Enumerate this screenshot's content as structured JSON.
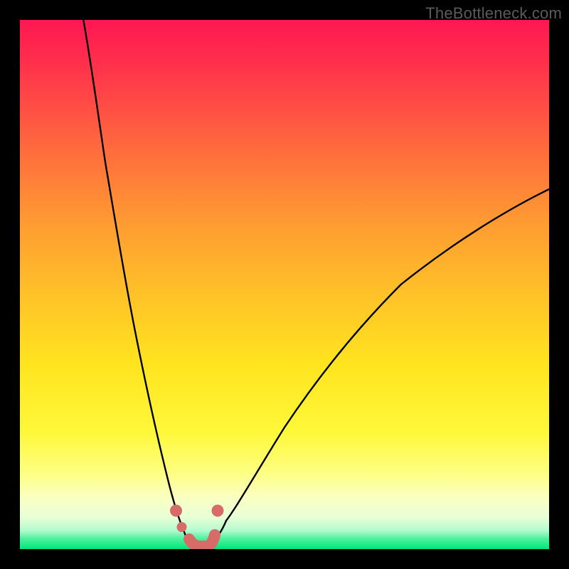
{
  "watermark": "TheBottleneck.com",
  "chart_data": {
    "type": "line",
    "title": "",
    "xlabel": "",
    "ylabel": "",
    "xlim": [
      0,
      100
    ],
    "ylim": [
      0,
      100
    ],
    "series": [
      {
        "name": "left-curve",
        "x": [
          12,
          15,
          18,
          20,
          22,
          24,
          26,
          28,
          29.5,
          31,
          32
        ],
        "y": [
          100,
          80,
          62,
          50,
          40,
          30,
          21,
          13,
          7.5,
          3,
          0.5
        ]
      },
      {
        "name": "right-curve",
        "x": [
          36,
          38,
          41,
          45,
          50,
          56,
          63,
          72,
          82,
          92,
          100
        ],
        "y": [
          0.5,
          3,
          8,
          15,
          23,
          32,
          41,
          50,
          58,
          64,
          68
        ]
      }
    ],
    "markers": [
      {
        "name": "marker-left-upper",
        "x": 29.5,
        "y": 7.3,
        "approx_percent": 7
      },
      {
        "name": "marker-left-mid",
        "x": 30.6,
        "y": 4.2,
        "approx_percent": 4
      },
      {
        "name": "marker-trough-left",
        "x": 32.0,
        "y": 1.3,
        "approx_percent": 1
      },
      {
        "name": "marker-trough-mid",
        "x": 33.7,
        "y": 0.7,
        "approx_percent": 1
      },
      {
        "name": "marker-trough-right",
        "x": 35.3,
        "y": 1.1,
        "approx_percent": 1
      },
      {
        "name": "marker-right-mid",
        "x": 36.6,
        "y": 3.0,
        "approx_percent": 3
      },
      {
        "name": "marker-right-upper",
        "x": 37.4,
        "y": 7.2,
        "approx_percent": 7
      }
    ],
    "gradient_meaning": "background color encodes bottleneck severity: red = high bottleneck, green = balanced",
    "gradient_stops": [
      {
        "pos": 0,
        "color": "#ff1752"
      },
      {
        "pos": 25,
        "color": "#ff6d3d"
      },
      {
        "pos": 52,
        "color": "#ffc228"
      },
      {
        "pos": 78,
        "color": "#fff83a"
      },
      {
        "pos": 94,
        "color": "#e8ffd6"
      },
      {
        "pos": 100,
        "color": "#00e77a"
      }
    ]
  }
}
